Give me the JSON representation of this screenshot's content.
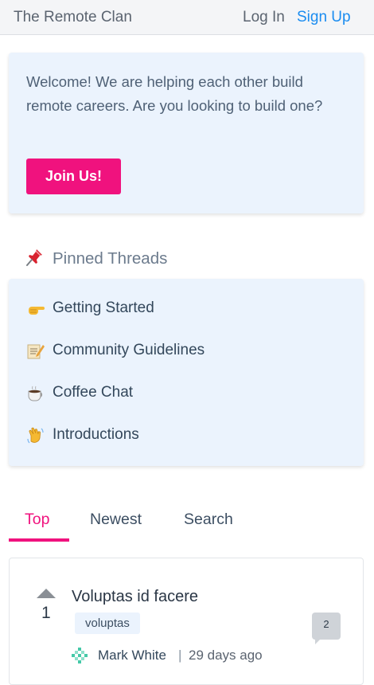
{
  "header": {
    "brand": "The Remote Clan",
    "login": "Log In",
    "signup": "Sign Up"
  },
  "welcome": {
    "text": "Welcome! We are helping each other build remote careers. Are you looking to build one?",
    "button": "Join Us!"
  },
  "pinned": {
    "title": "Pinned Threads",
    "icon": "pushpin-icon",
    "items": [
      {
        "icon": "pointing-hand-icon",
        "label": "Getting Started"
      },
      {
        "icon": "memo-icon",
        "label": "Community Guidelines"
      },
      {
        "icon": "coffee-icon",
        "label": "Coffee Chat"
      },
      {
        "icon": "waving-hand-icon",
        "label": "Introductions"
      }
    ]
  },
  "tabs": [
    {
      "label": "Top",
      "active": true
    },
    {
      "label": "Newest",
      "active": false
    },
    {
      "label": "Search",
      "active": false
    }
  ],
  "posts": [
    {
      "votes": "1",
      "title": "Voluptas id facere",
      "tag": "voluptas",
      "comments": "2",
      "author": "Mark White",
      "separator": "|",
      "time": "29 days ago"
    }
  ],
  "colors": {
    "accent": "#f0127e",
    "link": "#1a8cf0",
    "panel": "#ebf3fd"
  }
}
